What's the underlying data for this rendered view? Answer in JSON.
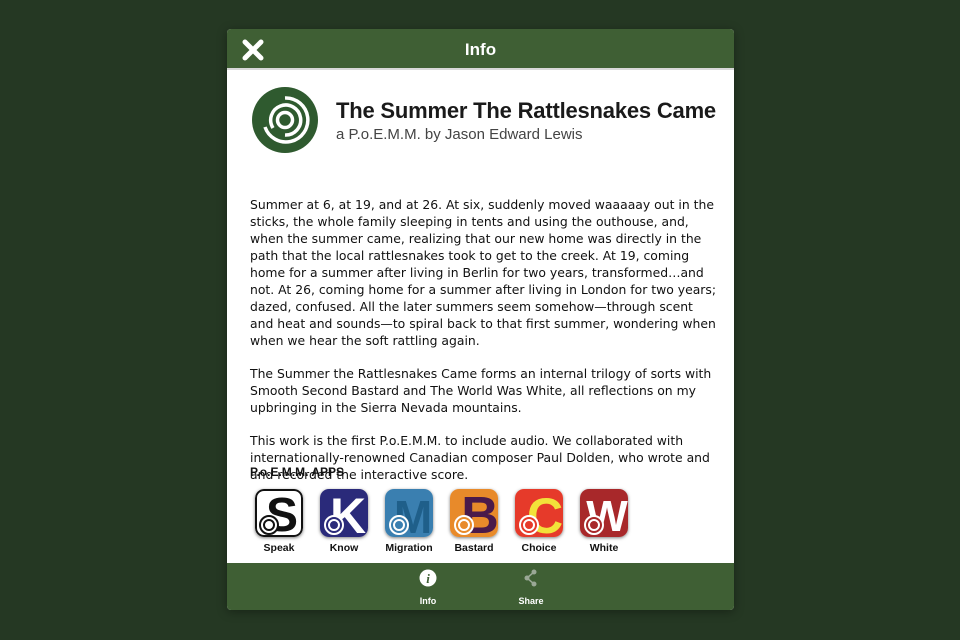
{
  "topbar": {
    "title": "Info",
    "close_icon": "close-icon"
  },
  "header": {
    "title": "The Summer The Rattlesnakes Came",
    "subtitle": "a P.o.E.M.M. by Jason Edward Lewis",
    "logo_icon": "spiral-logo-icon"
  },
  "body": {
    "paragraphs": [
      "Summer at 6, at 19, and at 26. At six, suddenly moved waaaaay out in the sticks, the whole family sleeping in tents and using the outhouse, and, when the summer came, realizing that our new home was directly in the path that the local rattlesnakes took to get to the creek. At 19, coming home for a summer after living in Berlin for two years, transformed…and not. At 26, coming home for a summer after living in London for two years; dazed, confused. All the later summers seem somehow—through scent and heat and sounds—to spiral back to that first summer, wondering when when we hear the soft rattling again.",
      "The Summer the Rattlesnakes Came forms an internal trilogy of sorts with Smooth Second Bastard and The World Was White, all reflections on my upbringing in the Sierra Nevada mountains.",
      "This work is the first P.o.E.M.M. to include audio. We collaborated with internationally-renowned Canadian composer Paul Dolden, who wrote and and recorded the interactive score."
    ]
  },
  "apps": {
    "heading": "P.o.E.M.M. APPS",
    "items": [
      {
        "label": "Speak",
        "letter": "S",
        "bg": "#ffffff",
        "fg": "#111111"
      },
      {
        "label": "Know",
        "letter": "K",
        "bg": "#2a2a7a",
        "fg": "#ffffff"
      },
      {
        "label": "Migration",
        "letter": "M",
        "bg": "#3a7fb0",
        "fg": "#1f5f8a"
      },
      {
        "label": "Bastard",
        "letter": "B",
        "bg": "#e88a2a",
        "fg": "#4a1a4a"
      },
      {
        "label": "Choice",
        "letter": "C",
        "bg": "#e63a2a",
        "fg": "#f2e23a"
      },
      {
        "label": "White",
        "letter": "W",
        "bg": "#a8282a",
        "fg": "#ffffff"
      }
    ]
  },
  "bottombar": {
    "items": [
      {
        "label": "Info",
        "icon": "info-icon"
      },
      {
        "label": "Share",
        "icon": "share-icon"
      }
    ]
  },
  "colors": {
    "bar": "#3f5f34",
    "background": "#253823",
    "logo": "#2f5a2f"
  }
}
